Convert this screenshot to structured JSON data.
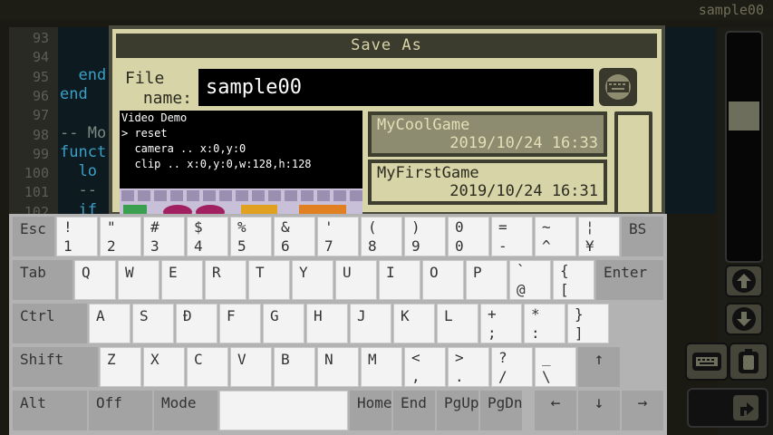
{
  "project_title": "sample00",
  "editor": {
    "line_numbers": [
      "93",
      "94",
      "95",
      "96",
      "97",
      "98",
      "99",
      "100",
      "101",
      "102"
    ],
    "code_lines": [
      {
        "text": "",
        "color": "#c8c8c8"
      },
      {
        "text": "",
        "color": "#c8c8c8"
      },
      {
        "text": "  end",
        "color": "#3aa0c8"
      },
      {
        "text": "end",
        "color": "#3aa0c8"
      },
      {
        "text": "",
        "color": "#c8c8c8"
      },
      {
        "text": "-- Mo",
        "color": "#7a8a80"
      },
      {
        "text": "funct",
        "color": "#3aa0c8"
      },
      {
        "text": "  lo",
        "color": "#3aa0c8"
      },
      {
        "text": "  --",
        "color": "#7a8a80"
      },
      {
        "text": "  if",
        "color": "#3aa0c8"
      }
    ]
  },
  "dialog": {
    "title": "Save As",
    "file_name_label_1": "File",
    "file_name_label_2": "name:",
    "file_name_value": "sample00",
    "preview_lines": [
      "Video Demo",
      "> reset",
      "  camera .. x:0,y:0",
      "  clip .. x:0,y:0,w:128,h:128"
    ],
    "files": [
      {
        "name": "MyCoolGame",
        "date": "2019/10/24 16:33",
        "selected": true
      },
      {
        "name": "MyFirstGame",
        "date": "2019/10/24 16:31",
        "selected": false
      }
    ]
  },
  "keyboard": {
    "row1": [
      {
        "top": "Esc",
        "bottom": "",
        "style": "g"
      },
      {
        "top": "!",
        "bottom": "1",
        "style": "w"
      },
      {
        "top": "\"",
        "bottom": "2",
        "style": "w"
      },
      {
        "top": "#",
        "bottom": "3",
        "style": "w"
      },
      {
        "top": "$",
        "bottom": "4",
        "style": "w"
      },
      {
        "top": "%",
        "bottom": "5",
        "style": "w"
      },
      {
        "top": "&",
        "bottom": "6",
        "style": "w"
      },
      {
        "top": "'",
        "bottom": "7",
        "style": "w"
      },
      {
        "top": "(",
        "bottom": "8",
        "style": "w"
      },
      {
        "top": ")",
        "bottom": "9",
        "style": "w"
      },
      {
        "top": "0",
        "bottom": "0",
        "style": "w"
      },
      {
        "top": "=",
        "bottom": "-",
        "style": "w"
      },
      {
        "top": "~",
        "bottom": "^",
        "style": "w"
      },
      {
        "top": "¦",
        "bottom": "¥",
        "style": "w"
      },
      {
        "top": "BS",
        "bottom": "",
        "style": "g"
      }
    ],
    "row2": [
      {
        "top": "Tab",
        "bottom": "",
        "style": "g"
      },
      {
        "top": "Q",
        "bottom": "",
        "style": "w"
      },
      {
        "top": "W",
        "bottom": "",
        "style": "w"
      },
      {
        "top": "E",
        "bottom": "",
        "style": "w"
      },
      {
        "top": "R",
        "bottom": "",
        "style": "w"
      },
      {
        "top": "T",
        "bottom": "",
        "style": "w"
      },
      {
        "top": "Y",
        "bottom": "",
        "style": "w"
      },
      {
        "top": "U",
        "bottom": "",
        "style": "w"
      },
      {
        "top": "I",
        "bottom": "",
        "style": "w"
      },
      {
        "top": "O",
        "bottom": "",
        "style": "w"
      },
      {
        "top": "P",
        "bottom": "",
        "style": "w"
      },
      {
        "top": "`",
        "bottom": "@",
        "style": "w"
      },
      {
        "top": "{",
        "bottom": "[",
        "style": "w"
      },
      {
        "top": "Enter",
        "bottom": "",
        "style": "g"
      }
    ],
    "row3": [
      {
        "top": "Ctrl",
        "bottom": "",
        "style": "g"
      },
      {
        "top": "A",
        "bottom": "",
        "style": "w"
      },
      {
        "top": "S",
        "bottom": "",
        "style": "w"
      },
      {
        "top": "Đ",
        "bottom": "",
        "style": "w"
      },
      {
        "top": "F",
        "bottom": "",
        "style": "w"
      },
      {
        "top": "G",
        "bottom": "",
        "style": "w"
      },
      {
        "top": "H",
        "bottom": "",
        "style": "w"
      },
      {
        "top": "J",
        "bottom": "",
        "style": "w"
      },
      {
        "top": "K",
        "bottom": "",
        "style": "w"
      },
      {
        "top": "L",
        "bottom": "",
        "style": "w"
      },
      {
        "top": "+",
        "bottom": ";",
        "style": "w"
      },
      {
        "top": "*",
        "bottom": ":",
        "style": "w"
      },
      {
        "top": "}",
        "bottom": "]",
        "style": "w"
      }
    ],
    "row4": [
      {
        "top": "Shift",
        "bottom": "",
        "style": "g"
      },
      {
        "top": "Z",
        "bottom": "",
        "style": "w"
      },
      {
        "top": "X",
        "bottom": "",
        "style": "w"
      },
      {
        "top": "C",
        "bottom": "",
        "style": "w"
      },
      {
        "top": "V",
        "bottom": "",
        "style": "w"
      },
      {
        "top": "B",
        "bottom": "",
        "style": "w"
      },
      {
        "top": "N",
        "bottom": "",
        "style": "w"
      },
      {
        "top": "M",
        "bottom": "",
        "style": "w"
      },
      {
        "top": "<",
        "bottom": ",",
        "style": "w"
      },
      {
        "top": ">",
        "bottom": ".",
        "style": "w"
      },
      {
        "top": "?",
        "bottom": "/",
        "style": "w"
      },
      {
        "top": "_",
        "bottom": "\\",
        "style": "w"
      },
      {
        "top": "↑",
        "bottom": "",
        "style": "g"
      }
    ],
    "row5": [
      {
        "top": "Alt",
        "bottom": "",
        "style": "g"
      },
      {
        "top": "Off",
        "bottom": "",
        "style": "g"
      },
      {
        "top": "Mode",
        "bottom": "",
        "style": "g"
      },
      {
        "top": "",
        "bottom": "",
        "style": "w"
      },
      {
        "top": "Home",
        "bottom": "",
        "style": "g"
      },
      {
        "top": "End",
        "bottom": "",
        "style": "g"
      },
      {
        "top": "PgUp",
        "bottom": "",
        "style": "g"
      },
      {
        "top": "PgDn",
        "bottom": "",
        "style": "g"
      },
      {
        "top": "←",
        "bottom": "",
        "style": "g"
      },
      {
        "top": "↓",
        "bottom": "",
        "style": "g"
      },
      {
        "top": "→",
        "bottom": "",
        "style": "g"
      }
    ]
  },
  "icons": {
    "keyboard_toggle": "keyboard-icon",
    "scroll_up": "arrow-up-icon",
    "scroll_down": "arrow-down-icon",
    "side_keyboard": "keyboard-icon",
    "side_clipboard": "clipboard-icon",
    "side_run": "run-arrow-icon"
  },
  "colors": {
    "dialog_bg": "#d7d4a8",
    "dialog_title_bg": "#3b3b2e",
    "selected_item_bg": "#8e8c70",
    "keyboard_bg": "#b3b3b3"
  }
}
